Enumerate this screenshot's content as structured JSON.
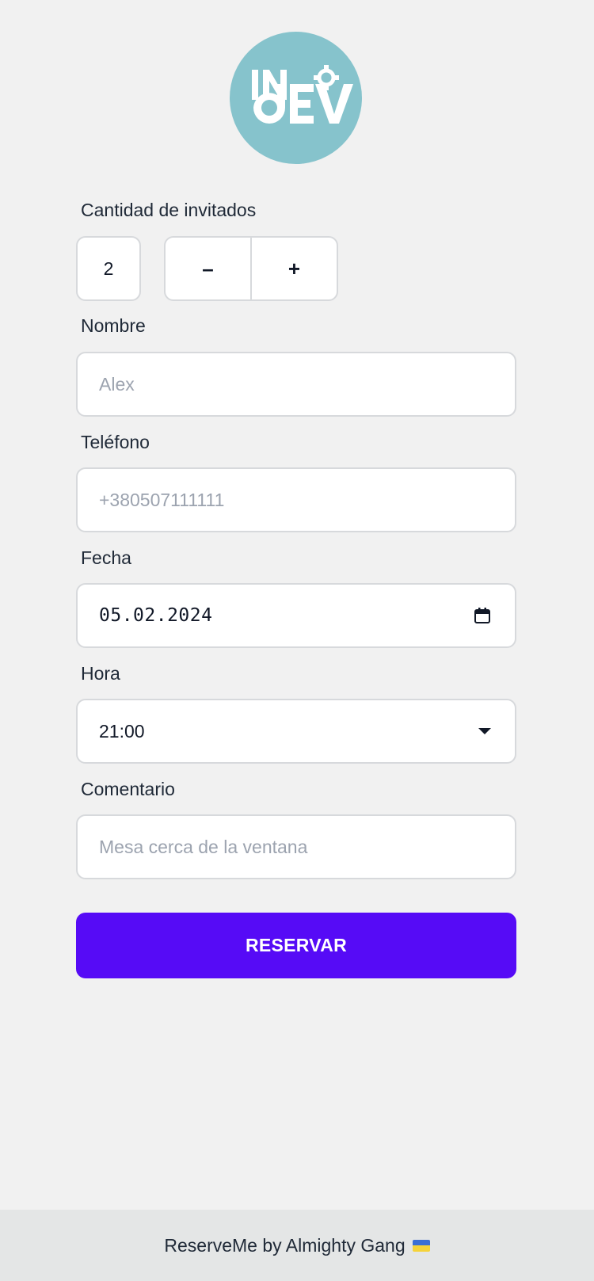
{
  "logo": {
    "text": "InDEV",
    "background": "#86c3cc"
  },
  "form": {
    "guests": {
      "label": "Cantidad de invitados",
      "value": "2",
      "minus_label": "–",
      "plus_label": "+"
    },
    "name": {
      "label": "Nombre",
      "placeholder": "Alex",
      "value": ""
    },
    "phone": {
      "label": "Teléfono",
      "placeholder": "+380507111111",
      "value": ""
    },
    "date": {
      "label": "Fecha",
      "value": "05.02.2024",
      "icon": "calendar-icon"
    },
    "time": {
      "label": "Hora",
      "value": "21:00",
      "icon": "chevron-down-icon"
    },
    "comment": {
      "label": "Comentario",
      "placeholder": "Mesa cerca de la ventana",
      "value": ""
    },
    "submit_label": "RESERVAR"
  },
  "footer": {
    "text": "ReserveMe by Almighty Gang",
    "flag_colors": [
      "#3b6fd4",
      "#f5d33a"
    ]
  },
  "colors": {
    "accent": "#560bf6",
    "background": "#f1f1f1",
    "footer_bg": "#e4e6e6"
  }
}
